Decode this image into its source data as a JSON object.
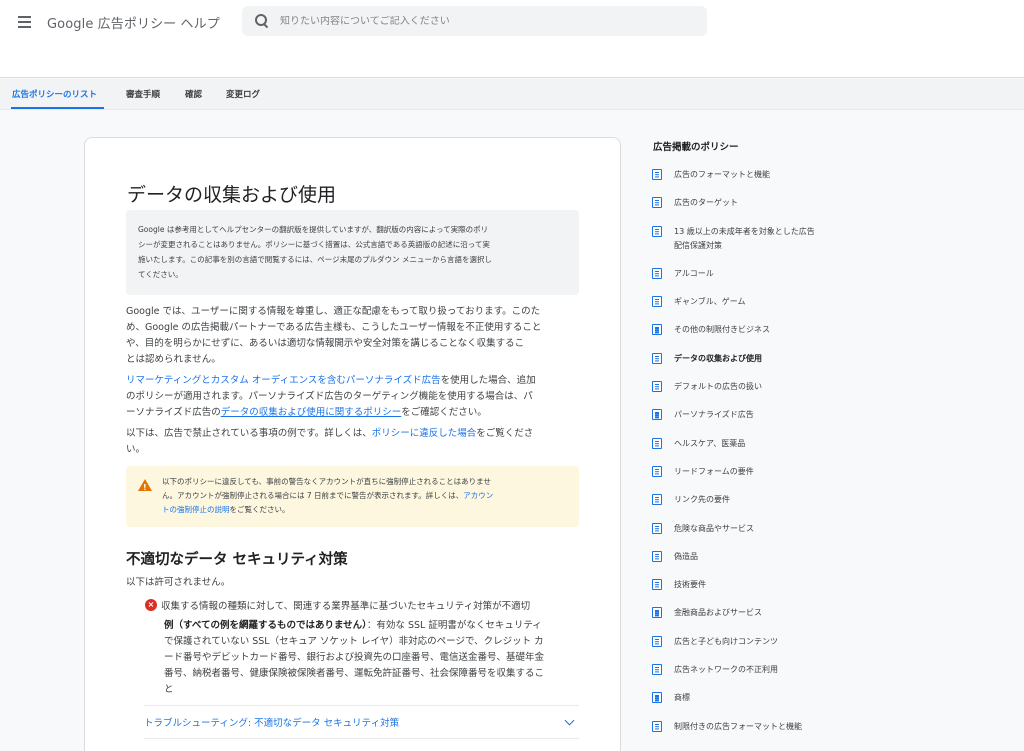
{
  "header": {
    "app_title": "Google 広告ポリシー ヘルプ",
    "search_placeholder": "知りたい内容についてご記入ください"
  },
  "tabs": [
    {
      "label": "広告ポリシーのリスト",
      "active": true
    },
    {
      "label": "審査手順",
      "active": false
    },
    {
      "label": "確認",
      "active": false
    },
    {
      "label": "変更ログ",
      "active": false
    }
  ],
  "article": {
    "title": "データの収集および使用",
    "notice_lines": [
      "Google は参考用としてヘルプセンターの翻訳版を提供していますが、翻訳版の内容によって実際のポリ",
      "シーが変更されることはありません。ポリシーに基づく措置は、公式言語である英語版の記述に沿って実",
      "施いたします。この記事を別の言語で閲覧するには、ページ末尾のプルダウン メニューから言語を選択し",
      "てください。"
    ],
    "para1_lines": [
      "Google では、ユーザーに関する情報を尊重し、適正な配慮をもって取り扱っております。このた",
      "め、Google の広告掲載パートナーである広告主様も、こうしたユーザー情報を不正使用すること",
      "や、目的を明らかにせずに、あるいは適切な情報開示や安全対策を講じることなく収集するこ",
      "とは認められません。"
    ],
    "para2": {
      "link1": "リマーケティングとカスタム オーディエンスを含むパーソナライズド広告",
      "text1": "を使用した場合、追加",
      "line2": "のポリシーが適用されます。パーソナライズド広告のターゲティング機能を使用する場合は、パ",
      "text3_pre": "ーソナライズド広告の",
      "link2": "データの収集および使用に関するポリシー",
      "text3_post": "をご確認ください。"
    },
    "para3": {
      "text_pre": "以下は、広告で禁止されている事項の例です。詳しくは、",
      "link": "ポリシーに違反した場合",
      "text_post": "をご覧くださ",
      "line2": "い。"
    },
    "warning": {
      "line1": "以下のポリシーに違反しても、事前の警告なくアカウントが直ちに強制停止されることはありませ",
      "line2_pre": "ん。アカウントが強制停止される場合には 7 日前までに警告が表示されます。詳しくは、",
      "link_part1": "アカウン",
      "link_part2": "トの強制停止の説明",
      "line3_post": "をご覧ください。"
    },
    "section_title": "不適切なデータ セキュリティ対策",
    "not_allowed": "以下は許可されません。",
    "bullet": "収集する情報の種類に対して、関連する業界基準に基づいたセキュリティ対策が不適切",
    "example": {
      "bold": "例（すべての例を網羅するものではありません）",
      "line1_rest": "：有効な SSL 証明書がなくセキュリティ",
      "line2": "で保護されていない SSL（セキュア ソケット レイヤ）非対応のページで、クレジット カ",
      "line3": "ード番号やデビットカード番号、銀行および投資先の口座番号、電信送金番号、基礎年金",
      "line4": "番号、納税者番号、健康保険被保険者番号、運転免許証番号、社会保障番号を収集するこ",
      "line5": "と"
    },
    "troubleshoot_label": "トラブルシューティング: 不適切なデータ セキュリティ対策"
  },
  "sidebar": {
    "title": "広告掲載のポリシー",
    "items": [
      {
        "label": "広告のフォーマットと機能"
      },
      {
        "label": "広告のターゲット"
      },
      {
        "label": "13 歳以上の未成年者を対象とした広告",
        "label2": "配信保護対策"
      },
      {
        "label": "アルコール"
      },
      {
        "label": "ギャンブル、ゲーム"
      },
      {
        "label": "その他の制限付きビジネス"
      },
      {
        "label": "データの収集および使用",
        "current": true
      },
      {
        "label": "デフォルトの広告の扱い"
      },
      {
        "label": "パーソナライズド広告"
      },
      {
        "label": "ヘルスケア、医薬品"
      },
      {
        "label": "リードフォームの要件"
      },
      {
        "label": "リンク先の要件"
      },
      {
        "label": "危険な商品やサービス"
      },
      {
        "label": "偽造品"
      },
      {
        "label": "技術要件"
      },
      {
        "label": "金融商品およびサービス"
      },
      {
        "label": "広告と子ども向けコンテンツ"
      },
      {
        "label": "広告ネットワークの不正利用"
      },
      {
        "label": "商標"
      },
      {
        "label": "制限付きの広告フォーマットと機能"
      }
    ]
  }
}
